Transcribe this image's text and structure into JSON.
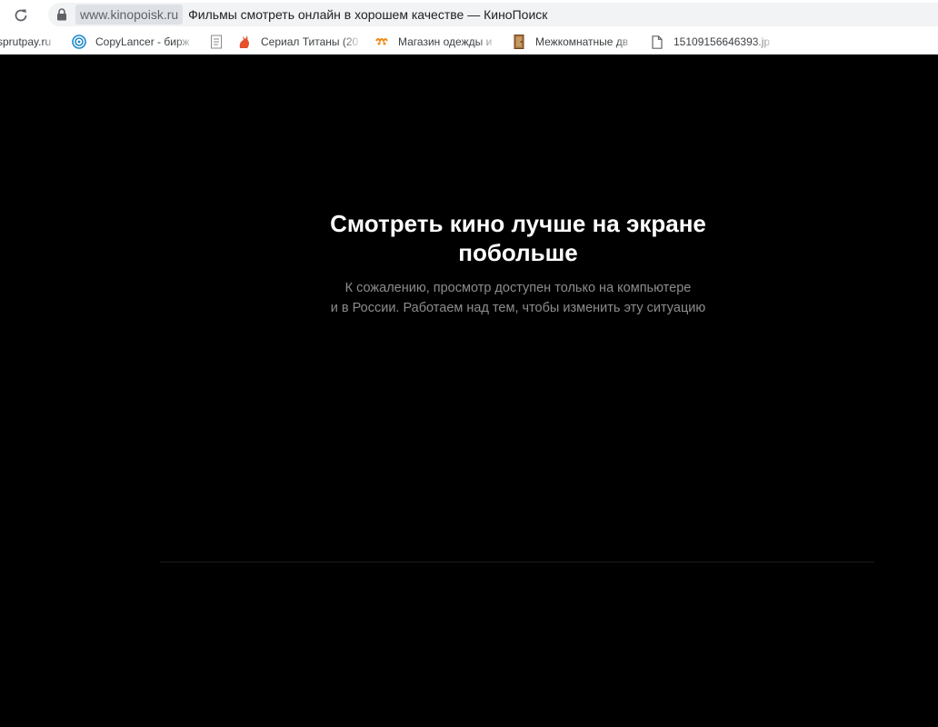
{
  "browser": {
    "domain": "www.kinopoisk.ru",
    "page_title": "Фильмы смотреть онлайн в хорошем качестве — КиноПоиск",
    "icons": {
      "reload": "reload-icon",
      "lock": "lock-icon"
    }
  },
  "bookmarks": [
    {
      "label": "sprutpay.ru",
      "icon": "none"
    },
    {
      "label": "CopyLancer - бирж",
      "icon": "copylancer-icon"
    },
    {
      "label": "",
      "icon": "document-icon"
    },
    {
      "label": "Сериал Титаны (20",
      "icon": "cat-icon"
    },
    {
      "label": "Магазин одежды и",
      "icon": "shop-icon"
    },
    {
      "label": "Межкомнатные дв",
      "icon": "door-icon"
    },
    {
      "label": "15109156646393.jp",
      "icon": "file-icon"
    }
  ],
  "main": {
    "headline_line1": "Смотреть кино лучше на экране",
    "headline_line2": "побольше",
    "sub_line1": "К сожалению, просмотр доступен только на компьютере",
    "sub_line2": "и в России. Работаем над тем, чтобы изменить эту ситуацию"
  },
  "colors": {
    "background": "#000000",
    "headline": "#ffffff",
    "subtext": "#8c8c8c"
  }
}
